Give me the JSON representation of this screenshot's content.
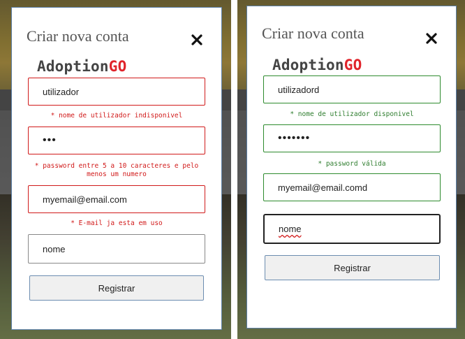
{
  "left": {
    "title": "Criar nova conta",
    "brand": {
      "name": "Adoption",
      "accent": "GO"
    },
    "username": {
      "value": "utilizador",
      "message": "* nome de utilizador indisponivel"
    },
    "password": {
      "value": "•••",
      "message": "* password entre 5 a 10 caracteres e pelo menos um numero"
    },
    "email": {
      "value": "myemail@email.com",
      "message": "* E-mail ja esta em uso"
    },
    "name": {
      "value": "nome"
    },
    "submit_label": "Registrar"
  },
  "right": {
    "title": "Criar nova conta",
    "brand": {
      "name": "Adoption",
      "accent": "GO"
    },
    "username": {
      "value": "utilizadord",
      "message": "* nome de utilizador disponivel"
    },
    "password": {
      "value": "•••••••",
      "message": "* password válida"
    },
    "email": {
      "value": "myemail@email.comd"
    },
    "name": {
      "value": "nome"
    },
    "submit_label": "Registrar"
  },
  "colors": {
    "error": "#d11a1a",
    "success": "#2e7d2e",
    "brand_accent": "#e0242b",
    "modal_border": "#5b7fa6"
  },
  "icons": {
    "close": "close-icon"
  }
}
